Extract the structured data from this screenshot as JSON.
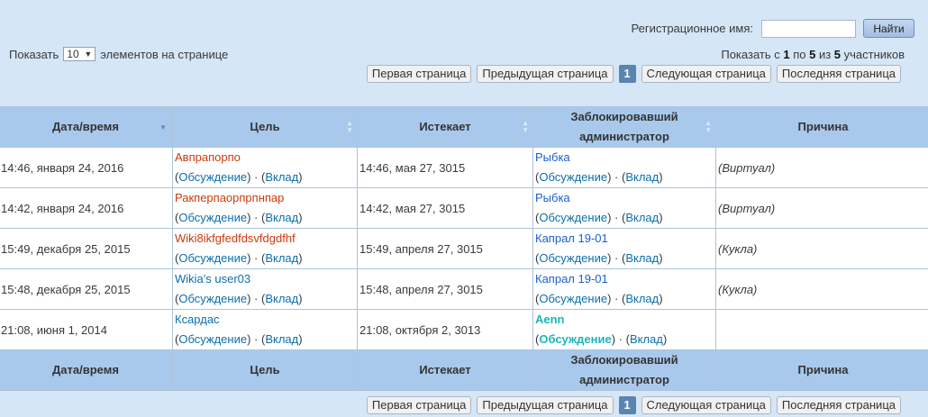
{
  "search": {
    "label": "Регистрационное имя:",
    "value": "",
    "button": "Найти"
  },
  "page_size": {
    "prefix": "Показать",
    "value": "10",
    "suffix": "элементов на странице"
  },
  "count": {
    "p1": "Показать с ",
    "from": "1",
    "p2": " по ",
    "to": "5",
    "p3": " из ",
    "total": "5",
    "p4": " участников"
  },
  "pager": {
    "first": "Первая страница",
    "prev": "Предыдущая страница",
    "current": "1",
    "next": "Следующая страница",
    "last": "Последняя страница"
  },
  "columns": [
    "Дата/время",
    "Цель",
    "Истекает",
    "Заблокировавший администратор",
    "Причина"
  ],
  "rows": [
    {
      "datetime": "14:46, января 24, 2016",
      "target": "Авпрапорпо",
      "talk": "Обсуждение",
      "contribs": "Вклад",
      "expires": "14:46, мая 27, 3015",
      "admin": "Рыбка",
      "reason": "(Виртуал)"
    },
    {
      "datetime": "14:42, января 24, 2016",
      "target": "Ракперпаорпрпнпар",
      "talk": "Обсуждение",
      "contribs": "Вклад",
      "expires": "14:42, мая 27, 3015",
      "admin": "Рыбка",
      "reason": "(Виртуал)"
    },
    {
      "datetime": "15:49, декабря 25, 2015",
      "target": "Wiki8ikfgfedfdsvfdgdfhf",
      "talk": "Обсуждение",
      "contribs": "Вклад",
      "expires": "15:49, апреля 27, 3015",
      "admin": "Капрал 19-01",
      "reason": "(Кукла)"
    },
    {
      "datetime": "15:48, декабря 25, 2015",
      "target": "Wikia's user03",
      "talk": "Обсуждение",
      "contribs": "Вклад",
      "expires": "15:48, апреля 27, 3015",
      "admin": "Капрал 19-01",
      "reason": "(Кукла)"
    },
    {
      "datetime": "21:08, июня 1, 2014",
      "target": "Ксардас",
      "talk": "Обсуждение",
      "contribs": "Вклад",
      "expires": "21:08, октября 2, 3013",
      "admin": "Aenn",
      "reason": ""
    }
  ],
  "colors": {
    "background": "#d5e6f6",
    "header": "#a9c9ec",
    "redlink": "#cc3a0e",
    "link": "#0b6fae",
    "admin_link": "#1a5fd1",
    "staff_link": "#1cb6b6"
  }
}
